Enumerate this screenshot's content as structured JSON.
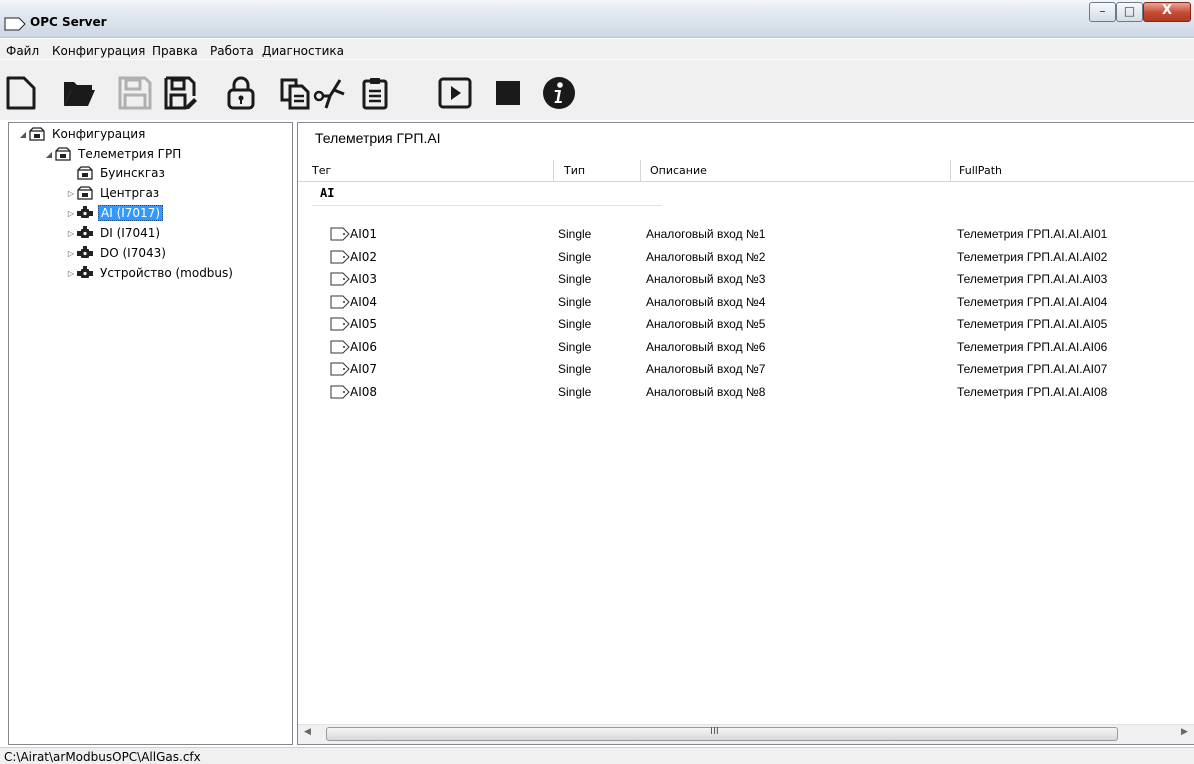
{
  "window": {
    "title": "OPC Server",
    "minimize_glyph": "–",
    "maximize_glyph": "□",
    "close_glyph": "X"
  },
  "menu": [
    "Файл",
    "Конфигурация",
    "Правка",
    "Работа",
    "Диагностика"
  ],
  "toolbar": {
    "icons": [
      "new-file-icon",
      "open-folder-icon",
      "save-icon",
      "save-as-icon",
      "lock-icon",
      "copy-icon",
      "cut-icon",
      "paste-icon",
      "play-icon",
      "stop-icon",
      "info-icon"
    ]
  },
  "tree": {
    "items": [
      {
        "label": "Конфигурация",
        "level": 0,
        "expander": "◢",
        "icon": "folder-icon"
      },
      {
        "label": "Телеметрия ГРП",
        "level": 1,
        "expander": "◢",
        "icon": "folder-icon"
      },
      {
        "label": "Буинскгаз",
        "level": 2,
        "expander": "",
        "icon": "folder-icon"
      },
      {
        "label": "Центргаз",
        "level": 2,
        "expander": "▷",
        "icon": "folder-icon"
      },
      {
        "label": "AI (I7017)",
        "level": 2,
        "expander": "▷",
        "icon": "device-icon",
        "selected": true
      },
      {
        "label": "DI (I7041)",
        "level": 2,
        "expander": "▷",
        "icon": "device-icon"
      },
      {
        "label": "DO (I7043)",
        "level": 2,
        "expander": "▷",
        "icon": "device-icon"
      },
      {
        "label": "Устройство (modbus)",
        "level": 2,
        "expander": "▷",
        "icon": "device-icon"
      }
    ]
  },
  "list": {
    "title": "Телеметрия ГРП.AI",
    "columns": [
      "Тег",
      "Тип",
      "Описание",
      "FullPath"
    ],
    "group": "AI",
    "rows": [
      {
        "tag": "AI01",
        "type": "Single",
        "desc": "Аналоговый вход №1",
        "path": "Телеметрия ГРП.AI.AI.AI01"
      },
      {
        "tag": "AI02",
        "type": "Single",
        "desc": "Аналоговый вход №2",
        "path": "Телеметрия ГРП.AI.AI.AI02"
      },
      {
        "tag": "AI03",
        "type": "Single",
        "desc": "Аналоговый вход №3",
        "path": "Телеметрия ГРП.AI.AI.AI03"
      },
      {
        "tag": "AI04",
        "type": "Single",
        "desc": "Аналоговый вход №4",
        "path": "Телеметрия ГРП.AI.AI.AI04"
      },
      {
        "tag": "AI05",
        "type": "Single",
        "desc": "Аналоговый вход №5",
        "path": "Телеметрия ГРП.AI.AI.AI05"
      },
      {
        "tag": "AI06",
        "type": "Single",
        "desc": "Аналоговый вход №6",
        "path": "Телеметрия ГРП.AI.AI.AI06"
      },
      {
        "tag": "AI07",
        "type": "Single",
        "desc": "Аналоговый вход №7",
        "path": "Телеметрия ГРП.AI.AI.AI07"
      },
      {
        "tag": "AI08",
        "type": "Single",
        "desc": "Аналоговый вход №8",
        "path": "Телеметрия ГРП.AI.AI.AI08"
      }
    ],
    "scroll_grip": "III"
  },
  "status": {
    "path": "C:\\Airat\\arModbusOPC\\AllGas.cfx"
  },
  "colors": {
    "selection": "#3399ff",
    "toolbar_icon": "#1a1a1a",
    "disabled_icon": "#b0b0b0"
  }
}
